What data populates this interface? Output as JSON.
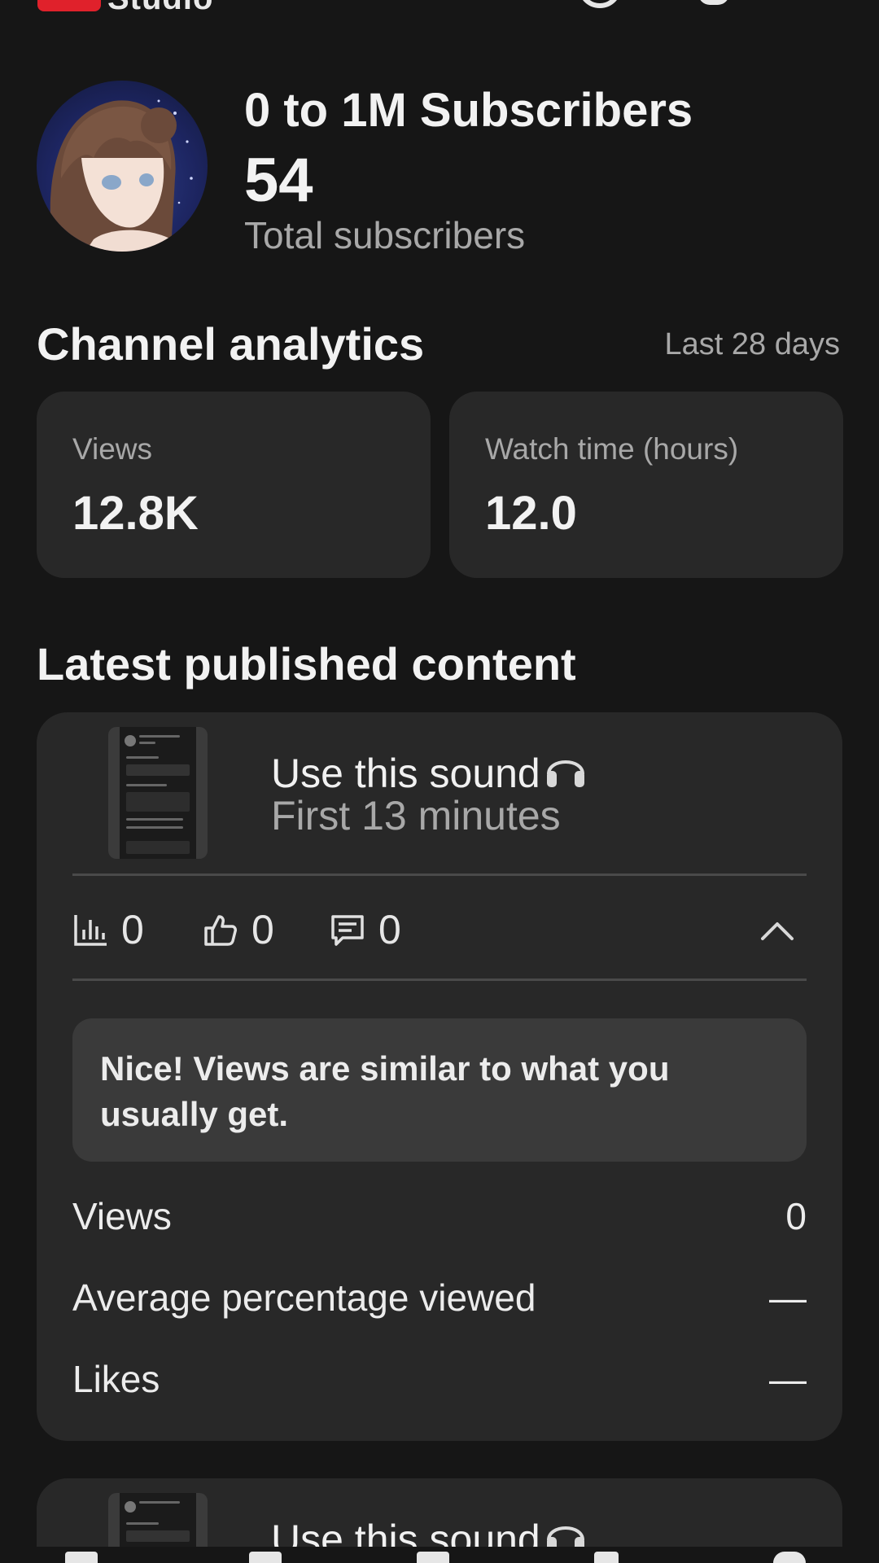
{
  "app": {
    "logo_text": "Studio"
  },
  "channel": {
    "name": "0 to 1M Subscribers",
    "subscriber_count": "54",
    "subscriber_label": "Total subscribers"
  },
  "analytics": {
    "title": "Channel analytics",
    "period": "Last 28 days",
    "cards": [
      {
        "label": "Views",
        "value": "12.8K"
      },
      {
        "label": "Watch time (hours)",
        "value": "12.0"
      }
    ]
  },
  "latest": {
    "title": "Latest published content",
    "items": [
      {
        "title": "Use this sound",
        "subtitle": "First 13 minutes",
        "views": "0",
        "likes": "0",
        "comments": "0",
        "insight": "Nice! Views are similar to what you usually get.",
        "rows": [
          {
            "label": "Views",
            "value": "0"
          },
          {
            "label": "Average percentage viewed",
            "value": "—"
          },
          {
            "label": "Likes",
            "value": "—"
          }
        ]
      },
      {
        "title": "Use this sound"
      }
    ]
  },
  "icons": {
    "help": "help-circle-icon",
    "notifications": "bell-icon",
    "headphones": "headphones-icon",
    "views_metric": "bar-chart-icon",
    "likes_metric": "thumbs-up-icon",
    "comments_metric": "comment-icon",
    "collapse": "chevron-up-icon"
  },
  "colors": {
    "background": "#161616",
    "card": "#282828",
    "brand": "#e0212b"
  }
}
